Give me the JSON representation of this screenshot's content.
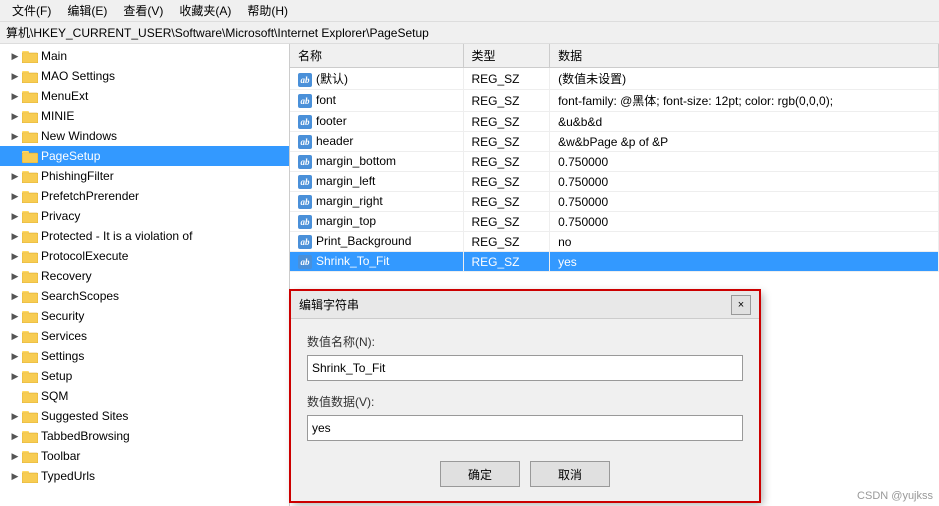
{
  "menubar": {
    "items": [
      {
        "label": "文件(F)"
      },
      {
        "label": "编辑(E)"
      },
      {
        "label": "查看(V)"
      },
      {
        "label": "收藏夹(A)"
      },
      {
        "label": "帮助(H)"
      }
    ]
  },
  "breadcrumb": {
    "text": "算机\\HKEY_CURRENT_USER\\Software\\Microsoft\\Internet Explorer\\PageSetup"
  },
  "tree": {
    "items": [
      {
        "label": "Main",
        "level": 1,
        "arrow": "closed"
      },
      {
        "label": "MAO Settings",
        "level": 1,
        "arrow": "closed"
      },
      {
        "label": "MenuExt",
        "level": 1,
        "arrow": "closed"
      },
      {
        "label": "MINIE",
        "level": 1,
        "arrow": "closed"
      },
      {
        "label": "New Windows",
        "level": 1,
        "arrow": "closed"
      },
      {
        "label": "PageSetup",
        "level": 1,
        "arrow": "empty",
        "selected": true
      },
      {
        "label": "PhishingFilter",
        "level": 1,
        "arrow": "closed"
      },
      {
        "label": "PrefetchPrerender",
        "level": 1,
        "arrow": "closed"
      },
      {
        "label": "Privacy",
        "level": 1,
        "arrow": "closed"
      },
      {
        "label": "Protected - It is a violation of",
        "level": 1,
        "arrow": "closed"
      },
      {
        "label": "ProtocolExecute",
        "level": 1,
        "arrow": "closed"
      },
      {
        "label": "Recovery",
        "level": 1,
        "arrow": "closed"
      },
      {
        "label": "SearchScopes",
        "level": 1,
        "arrow": "closed"
      },
      {
        "label": "Security",
        "level": 1,
        "arrow": "closed"
      },
      {
        "label": "Services",
        "level": 1,
        "arrow": "closed"
      },
      {
        "label": "Settings",
        "level": 1,
        "arrow": "closed"
      },
      {
        "label": "Setup",
        "level": 1,
        "arrow": "closed"
      },
      {
        "label": "SQM",
        "level": 1,
        "arrow": "empty"
      },
      {
        "label": "Suggested Sites",
        "level": 1,
        "arrow": "closed"
      },
      {
        "label": "TabbedBrowsing",
        "level": 1,
        "arrow": "closed"
      },
      {
        "label": "Toolbar",
        "level": 1,
        "arrow": "closed"
      },
      {
        "label": "TypedUrls",
        "level": 1,
        "arrow": "closed"
      }
    ]
  },
  "table": {
    "headers": [
      "名称",
      "类型",
      "数据"
    ],
    "rows": [
      {
        "icon": "ab",
        "name": "(默认)",
        "type": "REG_SZ",
        "data": "(数值未设置)"
      },
      {
        "icon": "ab",
        "name": "font",
        "type": "REG_SZ",
        "data": "font-family: @黑体; font-size: 12pt; color: rgb(0,0,0);"
      },
      {
        "icon": "ab",
        "name": "footer",
        "type": "REG_SZ",
        "data": "&u&b&d"
      },
      {
        "icon": "ab",
        "name": "header",
        "type": "REG_SZ",
        "data": "&w&bPage &p of &P"
      },
      {
        "icon": "ab",
        "name": "margin_bottom",
        "type": "REG_SZ",
        "data": "0.750000"
      },
      {
        "icon": "ab",
        "name": "margin_left",
        "type": "REG_SZ",
        "data": "0.750000"
      },
      {
        "icon": "ab",
        "name": "margin_right",
        "type": "REG_SZ",
        "data": "0.750000"
      },
      {
        "icon": "ab",
        "name": "margin_top",
        "type": "REG_SZ",
        "data": "0.750000"
      },
      {
        "icon": "ab",
        "name": "Print_Background",
        "type": "REG_SZ",
        "data": "no"
      },
      {
        "icon": "ab",
        "name": "Shrink_To_Fit",
        "type": "REG_SZ",
        "data": "yes",
        "selected": true
      }
    ]
  },
  "dialog": {
    "title": "编辑字符串",
    "close_btn": "×",
    "name_label": "数值名称(N):",
    "name_value": "Shrink_To_Fit",
    "data_label": "数值数据(V):",
    "data_value": "yes",
    "ok_btn": "确定",
    "cancel_btn": "取消"
  },
  "watermark": {
    "text": "CSDN @yujkss"
  }
}
